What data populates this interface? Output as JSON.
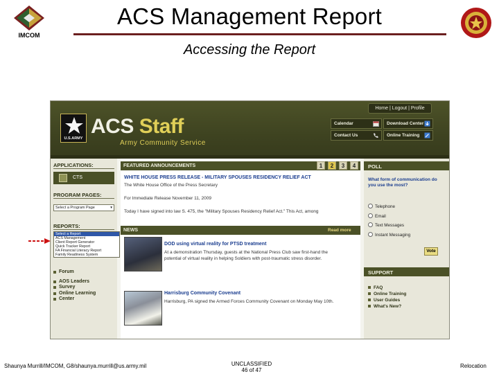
{
  "slide": {
    "title": "ACS Management Report",
    "subtitle": "Accessing the Report",
    "left_logo_text": "IMCOM"
  },
  "site": {
    "brand_word1": "ACS",
    "brand_word2": "Staff",
    "brand_sub": "Army Community Service",
    "army_badge": "U.S.ARMY",
    "top_links": "Home | Logout | Profile",
    "quick_buttons": [
      "Calendar",
      "Download Center",
      "Contact Us",
      "Online Training"
    ],
    "applications_label": "APPLICATIONS:",
    "cts_label": "CTS",
    "program_pages_label": "PROGRAM PAGES:",
    "program_select": "Select a Program Page",
    "reports_label": "REPORTS:",
    "reports_options": [
      "Select a Report",
      "ACS Management",
      "Client Report Generator",
      "Quick Tracker Report",
      "FA Financial Literacy Report",
      "Family Readiness System"
    ],
    "left_links": [
      "Forum",
      "AOS Leaders",
      "Survey",
      "Online Learning",
      "Center"
    ],
    "featured_label": "FEATURED ANNOUNCEMENTS",
    "pages": [
      "1",
      "2",
      "3",
      "4"
    ],
    "announcement_title": "WHITE HOUSE PRESS RELEASE - MILITARY SPOUSES RESIDENCY RELIEF ACT",
    "announcement_line1": "The White House Office of the Press Secretary",
    "announcement_line2": "For Immediate Release November 11, 2009",
    "announcement_line3": "Today I have signed into law S. 475, the \"Military Spouses Residency Relief Act.\" This Act, among",
    "news_label": "NEWS",
    "read_more": "Read more",
    "news1_title": "DOD using virtual reality for PTSD treatment",
    "news1_text1": "At a demonstration Thursday, guests at the National Press Club saw first-hand the",
    "news1_text2": "potential of virtual reality in helping Soldiers with post-traumatic stress disorder.",
    "news2_title": "Harrisburg Community Covenant",
    "news2_text": "Harrisburg, PA signed the Armed Forces Community Covenant on Monday May 10th.",
    "poll_label": "POLL",
    "poll_question": "What form of communication do you use the most?",
    "poll_options": [
      "Telephone",
      "Email",
      "Text Messages",
      "Instant Messaging"
    ],
    "vote_label": "Vote",
    "support_label": "SUPPORT",
    "support_links": [
      "FAQ",
      "Online Training",
      "User Guides",
      "What's New?"
    ]
  },
  "footer": {
    "left": "Shaunya Murrill/IMCOM, G8/shaunya.murrill@us.army.mil",
    "center_line1": "UNCLASSIFIED",
    "center_line2": "46 of 47",
    "right": "Relocation"
  },
  "colors": {
    "title_rule": "#6b1f1f",
    "site_olive": "#4b5127",
    "site_gold": "#e0cf58",
    "link_blue": "#1a3d8f",
    "arrow_red": "#cc1111"
  }
}
